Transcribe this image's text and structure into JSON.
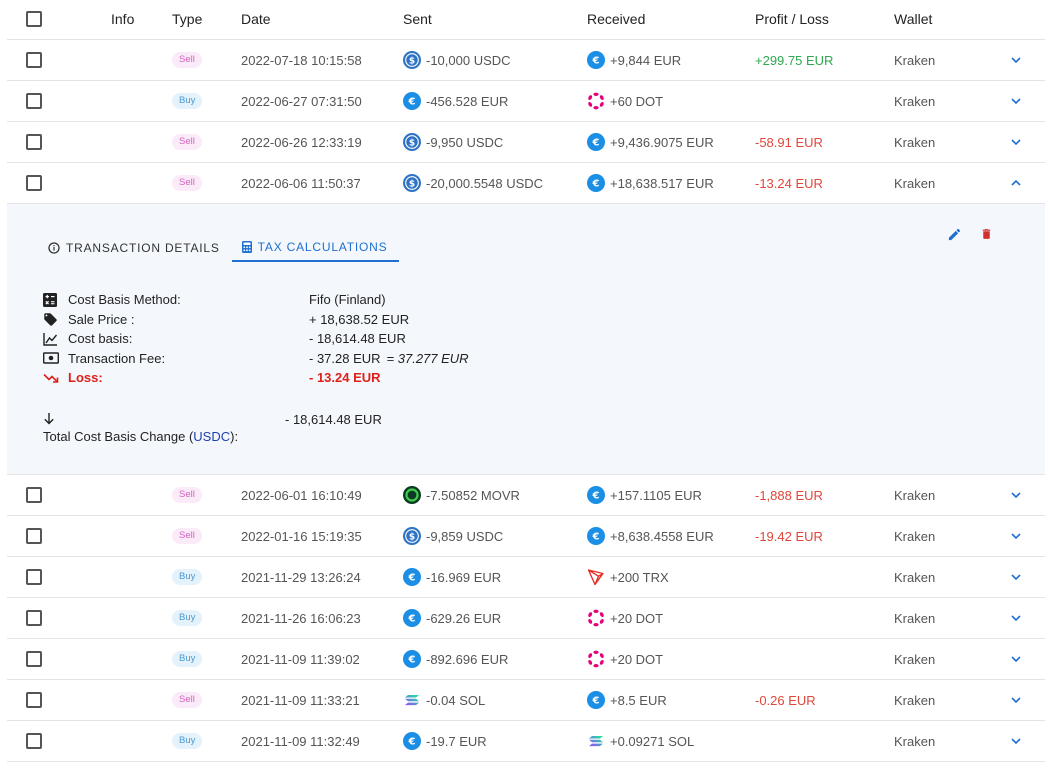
{
  "header": {
    "info": "Info",
    "type": "Type",
    "date": "Date",
    "sent": "Sent",
    "received": "Received",
    "profit_loss": "Profit / Loss",
    "wallet": "Wallet"
  },
  "rows_top": [
    {
      "type": "Sell",
      "date": "2022-07-18 10:15:58",
      "sent": "-10,000 USDC",
      "sent_coin": "usdc",
      "received": "+9,844 EUR",
      "recv_coin": "eur",
      "pl": "+299.75 EUR",
      "pl_kind": "profit",
      "wallet": "Kraken",
      "expanded": false
    },
    {
      "type": "Buy",
      "date": "2022-06-27 07:31:50",
      "sent": "-456.528 EUR",
      "sent_coin": "eur",
      "received": "+60 DOT",
      "recv_coin": "dot",
      "pl": "",
      "pl_kind": "",
      "wallet": "Kraken",
      "expanded": false
    },
    {
      "type": "Sell",
      "date": "2022-06-26 12:33:19",
      "sent": "-9,950 USDC",
      "sent_coin": "usdc",
      "received": "+9,436.9075 EUR",
      "recv_coin": "eur",
      "pl": "-58.91 EUR",
      "pl_kind": "loss",
      "wallet": "Kraken",
      "expanded": false
    },
    {
      "type": "Sell",
      "date": "2022-06-06 11:50:37",
      "sent": "-20,000.5548 USDC",
      "sent_coin": "usdc",
      "received": "+18,638.517 EUR",
      "recv_coin": "eur",
      "pl": "-13.24 EUR",
      "pl_kind": "loss",
      "wallet": "Kraken",
      "expanded": true
    }
  ],
  "details": {
    "tabs": [
      {
        "label": "TRANSACTION DETAILS",
        "active": false
      },
      {
        "label": "TAX CALCULATIONS",
        "active": true
      }
    ],
    "items": [
      {
        "label": "Cost Basis Method:",
        "value": "Fifo (Finland)",
        "extra": ""
      },
      {
        "label": "Sale Price :",
        "value": "+ 18,638.52 EUR",
        "extra": ""
      },
      {
        "label": "Cost basis:",
        "value": "- 18,614.48 EUR",
        "extra": ""
      },
      {
        "label": "Transaction Fee:",
        "value": "- 37.28 EUR",
        "extra": "= 37.277 EUR"
      },
      {
        "label": "Loss:",
        "value": "- 13.24 EUR",
        "extra": ""
      }
    ],
    "total_label_prefix": "Total Cost Basis Change (",
    "total_label_link": "USDC",
    "total_label_suffix": "):",
    "total_value": "- 18,614.48 EUR"
  },
  "rows_bottom": [
    {
      "type": "Sell",
      "date": "2022-06-01 16:10:49",
      "sent": "-7.50852 MOVR",
      "sent_coin": "movr",
      "received": "+157.1105 EUR",
      "recv_coin": "eur",
      "pl": "-1,888 EUR",
      "pl_kind": "loss",
      "wallet": "Kraken",
      "expanded": false
    },
    {
      "type": "Sell",
      "date": "2022-01-16 15:19:35",
      "sent": "-9,859 USDC",
      "sent_coin": "usdc",
      "received": "+8,638.4558 EUR",
      "recv_coin": "eur",
      "pl": "-19.42 EUR",
      "pl_kind": "loss",
      "wallet": "Kraken",
      "expanded": false
    },
    {
      "type": "Buy",
      "date": "2021-11-29 13:26:24",
      "sent": "-16.969 EUR",
      "sent_coin": "eur",
      "received": "+200 TRX",
      "recv_coin": "trx",
      "pl": "",
      "pl_kind": "",
      "wallet": "Kraken",
      "expanded": false
    },
    {
      "type": "Buy",
      "date": "2021-11-26 16:06:23",
      "sent": "-629.26 EUR",
      "sent_coin": "eur",
      "received": "+20 DOT",
      "recv_coin": "dot",
      "pl": "",
      "pl_kind": "",
      "wallet": "Kraken",
      "expanded": false
    },
    {
      "type": "Buy",
      "date": "2021-11-09 11:39:02",
      "sent": "-892.696 EUR",
      "sent_coin": "eur",
      "received": "+20 DOT",
      "recv_coin": "dot",
      "pl": "",
      "pl_kind": "",
      "wallet": "Kraken",
      "expanded": false
    },
    {
      "type": "Sell",
      "date": "2021-11-09 11:33:21",
      "sent": "-0.04 SOL",
      "sent_coin": "sol",
      "received": "+8.5 EUR",
      "recv_coin": "eur",
      "pl": "-0.26 EUR",
      "pl_kind": "loss",
      "wallet": "Kraken",
      "expanded": false
    },
    {
      "type": "Buy",
      "date": "2021-11-09 11:32:49",
      "sent": "-19.7 EUR",
      "sent_coin": "eur",
      "received": "+0.09271 SOL",
      "recv_coin": "sol",
      "pl": "",
      "pl_kind": "",
      "wallet": "Kraken",
      "expanded": false
    }
  ],
  "colors": {
    "accent": "#1f6fd1",
    "profit": "#2fa84f",
    "loss": "#e0473b",
    "delete": "#d32f2f",
    "sell_badge": "#d661c3",
    "buy_badge": "#4a98d0"
  }
}
